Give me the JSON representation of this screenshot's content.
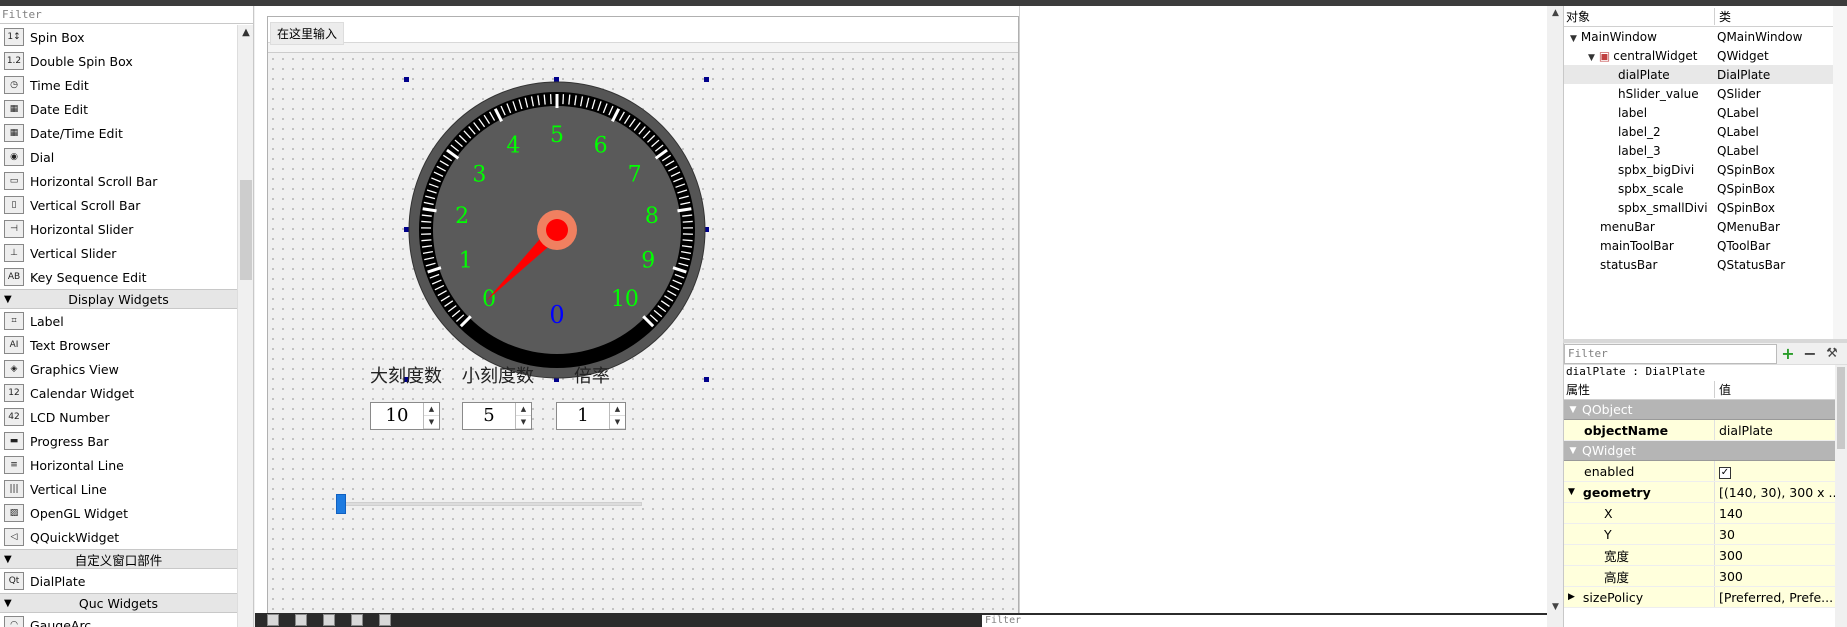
{
  "widget_box": {
    "filter_placeholder": "Filter",
    "top_items": [
      {
        "label": "Spin Box",
        "icon": "spin-box-icon",
        "glyph": "1↕"
      },
      {
        "label": "Double Spin Box",
        "icon": "double-spin-box-icon",
        "glyph": "1.2"
      },
      {
        "label": "Time Edit",
        "icon": "clock-icon",
        "glyph": "◷"
      },
      {
        "label": "Date Edit",
        "icon": "calendar-icon",
        "glyph": "▦"
      },
      {
        "label": "Date/Time Edit",
        "icon": "datetime-icon",
        "glyph": "▦"
      },
      {
        "label": "Dial",
        "icon": "dial-icon",
        "glyph": "◉"
      },
      {
        "label": "Horizontal Scroll Bar",
        "icon": "horizontal-scrollbar-icon",
        "glyph": "▭"
      },
      {
        "label": "Vertical Scroll Bar",
        "icon": "vertical-scrollbar-icon",
        "glyph": "▯"
      },
      {
        "label": "Horizontal Slider",
        "icon": "horizontal-slider-icon",
        "glyph": "⊣"
      },
      {
        "label": "Vertical Slider",
        "icon": "vertical-slider-icon",
        "glyph": "⊥"
      },
      {
        "label": "Key Sequence Edit",
        "icon": "key-sequence-icon",
        "glyph": "AB"
      }
    ],
    "cat_display": "Display Widgets",
    "display_items": [
      {
        "label": "Label",
        "icon": "label-icon",
        "glyph": "⌗"
      },
      {
        "label": "Text Browser",
        "icon": "text-browser-icon",
        "glyph": "AI"
      },
      {
        "label": "Graphics View",
        "icon": "graphics-view-icon",
        "glyph": "◈"
      },
      {
        "label": "Calendar Widget",
        "icon": "calendar-widget-icon",
        "glyph": "12"
      },
      {
        "label": "LCD Number",
        "icon": "lcd-number-icon",
        "glyph": "42"
      },
      {
        "label": "Progress Bar",
        "icon": "progress-bar-icon",
        "glyph": "▬"
      },
      {
        "label": "Horizontal Line",
        "icon": "horizontal-line-icon",
        "glyph": "≡"
      },
      {
        "label": "Vertical Line",
        "icon": "vertical-line-icon",
        "glyph": "|||"
      },
      {
        "label": "OpenGL Widget",
        "icon": "opengl-widget-icon",
        "glyph": "▨"
      },
      {
        "label": "QQuickWidget",
        "icon": "qquickwidget-icon",
        "glyph": "◁"
      }
    ],
    "cat_custom": "自定义窗口部件",
    "custom_items": [
      {
        "label": "DialPlate",
        "icon": "dialplate-icon",
        "glyph": "Qt"
      }
    ],
    "cat_quc": "Quc Widgets",
    "quc_items": [
      {
        "label": "GaugeArc",
        "icon": "gauge-arc-icon",
        "glyph": "◠"
      }
    ]
  },
  "form": {
    "menu_placeholder": "在这里输入",
    "labels": {
      "big": "大刻度数",
      "small": "小刻度数",
      "scale": "倍率"
    },
    "spin_big": "10",
    "spin_small": "5",
    "spin_scale": "1",
    "slider_value": 0
  },
  "dial": {
    "numbers": [
      "0",
      "1",
      "2",
      "3",
      "4",
      "5",
      "6",
      "7",
      "8",
      "9",
      "10"
    ],
    "value_text": "0",
    "value": 0,
    "big_divisions": 10,
    "small_divisions": 5,
    "colors": {
      "numbers": "#00ff00",
      "value": "#0000ff",
      "needle": "#ff0000",
      "face": "#5a5a5a",
      "ticks": "#ffffff",
      "hub": "#f08060"
    }
  },
  "bottom_filter": "Filter",
  "object_inspector": {
    "header_object": "对象",
    "header_class": "类",
    "rows": [
      {
        "name": "MainWindow",
        "cls": "QMainWindow",
        "indent": 0,
        "expand": "v"
      },
      {
        "name": "centralWidget",
        "cls": "QWidget",
        "indent": 1,
        "expand": "v"
      },
      {
        "name": "dialPlate",
        "cls": "DialPlate",
        "indent": 2,
        "expand": ""
      },
      {
        "name": "hSlider_value",
        "cls": "QSlider",
        "indent": 2,
        "expand": ""
      },
      {
        "name": "label",
        "cls": "QLabel",
        "indent": 2,
        "expand": ""
      },
      {
        "name": "label_2",
        "cls": "QLabel",
        "indent": 2,
        "expand": ""
      },
      {
        "name": "label_3",
        "cls": "QLabel",
        "indent": 2,
        "expand": ""
      },
      {
        "name": "spbx_bigDivi",
        "cls": "QSpinBox",
        "indent": 2,
        "expand": ""
      },
      {
        "name": "spbx_scale",
        "cls": "QSpinBox",
        "indent": 2,
        "expand": ""
      },
      {
        "name": "spbx_smallDivi",
        "cls": "QSpinBox",
        "indent": 2,
        "expand": ""
      },
      {
        "name": "menuBar",
        "cls": "QMenuBar",
        "indent": 1,
        "expand": ""
      },
      {
        "name": "mainToolBar",
        "cls": "QToolBar",
        "indent": 1,
        "expand": ""
      },
      {
        "name": "statusBar",
        "cls": "QStatusBar",
        "indent": 1,
        "expand": ""
      }
    ]
  },
  "property_editor": {
    "filter_placeholder": "Filter",
    "object_line": "dialPlate : DialPlate",
    "header_prop": "属性",
    "header_value": "值",
    "group_qobject": "QObject",
    "objectName_label": "objectName",
    "objectName_value": "dialPlate",
    "group_qwidget": "QWidget",
    "enabled_label": "enabled",
    "enabled_checked": true,
    "geometry_label": "geometry",
    "geometry_value": "[(140, 30), 300 x ...",
    "x_label": "X",
    "x_value": "140",
    "y_label": "Y",
    "y_value": "30",
    "w_label": "宽度",
    "w_value": "300",
    "h_label": "高度",
    "h_value": "300",
    "sizepolicy_label": "sizePolicy",
    "sizepolicy_value": "[Preferred, Prefe..."
  }
}
